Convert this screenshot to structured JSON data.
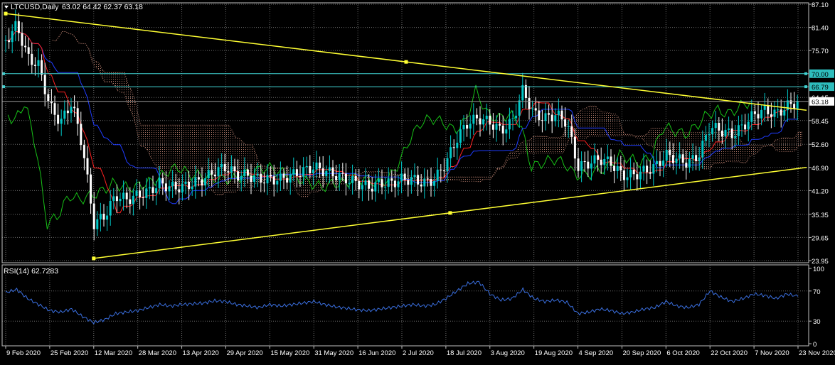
{
  "header": {
    "symbol_label": "LTCUSD,Daily",
    "ohlc_label": "63.02 64.42 62.37 63.18"
  },
  "rsi_header": {
    "label": "RSI(14) 62.7283"
  },
  "colors": {
    "background": "#000000",
    "frame": "#c0c0c0",
    "grid": "#6b6b6b",
    "bull_candle": "#00c8c8",
    "bear_candle": "#ffffff",
    "trendline": "#ffff33",
    "tenkan": "#ff2020",
    "kijun": "#1f3cff",
    "chikou": "#17c017",
    "cloud": "#b07a6a",
    "hline": "#3fcfcf",
    "rsi_line": "#3a6fe0",
    "price_marker_bg": "#ffffff",
    "level_marker_bg": "#2ebdbd"
  },
  "chart_data": [
    {
      "type": "candlestick",
      "title": "LTCUSD,Daily",
      "price_axis_ticks": [
        "87.10",
        "81.40",
        "75.70",
        "64.15",
        "58.45",
        "52.60",
        "46.90",
        "41.20",
        "35.35",
        "29.65",
        "23.95"
      ],
      "x_tick_labels": [
        "9 Feb 2020",
        "25 Feb 2020",
        "12 Mar 2020",
        "28 Mar 2020",
        "13 Apr 2020",
        "29 Apr 2020",
        "15 May 2020",
        "31 May 2020",
        "16 Jun 2020",
        "2 Jul 2020",
        "18 Jul 2020",
        "3 Aug 2020",
        "19 Aug 2020",
        "4 Sep 2020",
        "20 Sep 2020",
        "6 Oct 2020",
        "22 Oct 2020",
        "7 Nov 2020",
        "23 Nov 2020"
      ],
      "ylim": [
        23.95,
        87.1
      ],
      "horizontal_levels": [
        {
          "value": 70.0,
          "label": "70.00"
        },
        {
          "value": 66.79,
          "label": "66.79"
        }
      ],
      "current_price": {
        "value": 63.18,
        "label": "63.18"
      },
      "trendlines": [
        {
          "from": {
            "x": "9 Feb 2020",
            "y": 84.8
          },
          "to": {
            "x": "23 Nov 2020",
            "y": 61.0
          }
        },
        {
          "from": {
            "x": "12 Mar 2020",
            "y": 24.5
          },
          "to": {
            "x": "23 Nov 2020",
            "y": 46.9
          }
        }
      ],
      "indicators": [
        "Ichimoku Kinko Hyo"
      ],
      "closes": [
        {
          "x": "9 Feb 2020",
          "y": 78
        },
        {
          "x": "13 Feb 2020",
          "y": 82
        },
        {
          "x": "17 Feb 2020",
          "y": 74
        },
        {
          "x": "21 Feb 2020",
          "y": 72
        },
        {
          "x": "25 Feb 2020",
          "y": 62
        },
        {
          "x": "29 Feb 2020",
          "y": 58
        },
        {
          "x": "4 Mar 2020",
          "y": 63
        },
        {
          "x": "8 Mar 2020",
          "y": 52
        },
        {
          "x": "12 Mar 2020",
          "y": 33
        },
        {
          "x": "16 Mar 2020",
          "y": 35
        },
        {
          "x": "20 Mar 2020",
          "y": 40
        },
        {
          "x": "24 Mar 2020",
          "y": 39
        },
        {
          "x": "28 Mar 2020",
          "y": 40
        },
        {
          "x": "1 Apr 2020",
          "y": 41
        },
        {
          "x": "5 Apr 2020",
          "y": 43
        },
        {
          "x": "9 Apr 2020",
          "y": 42
        },
        {
          "x": "13 Apr 2020",
          "y": 42
        },
        {
          "x": "17 Apr 2020",
          "y": 43
        },
        {
          "x": "21 Apr 2020",
          "y": 44
        },
        {
          "x": "25 Apr 2020",
          "y": 46
        },
        {
          "x": "29 Apr 2020",
          "y": 47
        },
        {
          "x": "3 May 2020",
          "y": 45
        },
        {
          "x": "7 May 2020",
          "y": 45
        },
        {
          "x": "11 May 2020",
          "y": 44
        },
        {
          "x": "15 May 2020",
          "y": 44
        },
        {
          "x": "19 May 2020",
          "y": 44
        },
        {
          "x": "23 May 2020",
          "y": 45
        },
        {
          "x": "27 May 2020",
          "y": 46
        },
        {
          "x": "31 May 2020",
          "y": 47
        },
        {
          "x": "4 Jun 2020",
          "y": 46
        },
        {
          "x": "8 Jun 2020",
          "y": 45
        },
        {
          "x": "12 Jun 2020",
          "y": 44
        },
        {
          "x": "16 Jun 2020",
          "y": 43
        },
        {
          "x": "20 Jun 2020",
          "y": 42
        },
        {
          "x": "24 Jun 2020",
          "y": 43
        },
        {
          "x": "28 Jun 2020",
          "y": 43
        },
        {
          "x": "2 Jul 2020",
          "y": 44
        },
        {
          "x": "6 Jul 2020",
          "y": 44
        },
        {
          "x": "10 Jul 2020",
          "y": 43
        },
        {
          "x": "14 Jul 2020",
          "y": 44
        },
        {
          "x": "18 Jul 2020",
          "y": 48
        },
        {
          "x": "22 Jul 2020",
          "y": 54
        },
        {
          "x": "26 Jul 2020",
          "y": 58
        },
        {
          "x": "30 Jul 2020",
          "y": 59
        },
        {
          "x": "3 Aug 2020",
          "y": 58
        },
        {
          "x": "7 Aug 2020",
          "y": 56
        },
        {
          "x": "11 Aug 2020",
          "y": 58
        },
        {
          "x": "15 Aug 2020",
          "y": 66
        },
        {
          "x": "19 Aug 2020",
          "y": 60
        },
        {
          "x": "23 Aug 2020",
          "y": 59
        },
        {
          "x": "27 Aug 2020",
          "y": 60
        },
        {
          "x": "31 Aug 2020",
          "y": 58
        },
        {
          "x": "4 Sep 2020",
          "y": 47
        },
        {
          "x": "8 Sep 2020",
          "y": 48
        },
        {
          "x": "12 Sep 2020",
          "y": 49
        },
        {
          "x": "16 Sep 2020",
          "y": 48
        },
        {
          "x": "20 Sep 2020",
          "y": 45
        },
        {
          "x": "24 Sep 2020",
          "y": 45
        },
        {
          "x": "28 Sep 2020",
          "y": 46
        },
        {
          "x": "2 Oct 2020",
          "y": 47
        },
        {
          "x": "6 Oct 2020",
          "y": 50
        },
        {
          "x": "10 Oct 2020",
          "y": 49
        },
        {
          "x": "14 Oct 2020",
          "y": 48
        },
        {
          "x": "18 Oct 2020",
          "y": 50
        },
        {
          "x": "22 Oct 2020",
          "y": 57
        },
        {
          "x": "26 Oct 2020",
          "y": 56
        },
        {
          "x": "30 Oct 2020",
          "y": 55
        },
        {
          "x": "3 Nov 2020",
          "y": 57
        },
        {
          "x": "7 Nov 2020",
          "y": 60
        },
        {
          "x": "11 Nov 2020",
          "y": 61
        },
        {
          "x": "15 Nov 2020",
          "y": 60
        },
        {
          "x": "19 Nov 2020",
          "y": 62
        },
        {
          "x": "23 Nov 2020",
          "y": 63.18
        }
      ]
    },
    {
      "type": "line",
      "title": "RSI(14) 62.7283",
      "ylim": [
        0,
        100
      ],
      "y_tick_labels": [
        "100",
        "70",
        "30",
        "0"
      ],
      "guide_levels": [
        70,
        30
      ],
      "series": [
        {
          "name": "RSI(14)",
          "values": [
            {
              "x": "9 Feb 2020",
              "y": 68
            },
            {
              "x": "13 Feb 2020",
              "y": 72
            },
            {
              "x": "17 Feb 2020",
              "y": 60
            },
            {
              "x": "21 Feb 2020",
              "y": 52
            },
            {
              "x": "25 Feb 2020",
              "y": 44
            },
            {
              "x": "29 Feb 2020",
              "y": 42
            },
            {
              "x": "4 Mar 2020",
              "y": 46
            },
            {
              "x": "8 Mar 2020",
              "y": 36
            },
            {
              "x": "12 Mar 2020",
              "y": 28
            },
            {
              "x": "16 Mar 2020",
              "y": 32
            },
            {
              "x": "20 Mar 2020",
              "y": 40
            },
            {
              "x": "24 Mar 2020",
              "y": 42
            },
            {
              "x": "28 Mar 2020",
              "y": 44
            },
            {
              "x": "1 Apr 2020",
              "y": 48
            },
            {
              "x": "5 Apr 2020",
              "y": 52
            },
            {
              "x": "9 Apr 2020",
              "y": 50
            },
            {
              "x": "13 Apr 2020",
              "y": 52
            },
            {
              "x": "17 Apr 2020",
              "y": 53
            },
            {
              "x": "21 Apr 2020",
              "y": 54
            },
            {
              "x": "25 Apr 2020",
              "y": 57
            },
            {
              "x": "29 Apr 2020",
              "y": 56
            },
            {
              "x": "3 May 2020",
              "y": 52
            },
            {
              "x": "7 May 2020",
              "y": 50
            },
            {
              "x": "11 May 2020",
              "y": 48
            },
            {
              "x": "15 May 2020",
              "y": 52
            },
            {
              "x": "19 May 2020",
              "y": 50
            },
            {
              "x": "23 May 2020",
              "y": 52
            },
            {
              "x": "27 May 2020",
              "y": 54
            },
            {
              "x": "31 May 2020",
              "y": 56
            },
            {
              "x": "4 Jun 2020",
              "y": 52
            },
            {
              "x": "8 Jun 2020",
              "y": 49
            },
            {
              "x": "12 Jun 2020",
              "y": 47
            },
            {
              "x": "16 Jun 2020",
              "y": 45
            },
            {
              "x": "20 Jun 2020",
              "y": 44
            },
            {
              "x": "24 Jun 2020",
              "y": 46
            },
            {
              "x": "28 Jun 2020",
              "y": 48
            },
            {
              "x": "2 Jul 2020",
              "y": 50
            },
            {
              "x": "6 Jul 2020",
              "y": 52
            },
            {
              "x": "10 Jul 2020",
              "y": 50
            },
            {
              "x": "14 Jul 2020",
              "y": 52
            },
            {
              "x": "18 Jul 2020",
              "y": 60
            },
            {
              "x": "22 Jul 2020",
              "y": 70
            },
            {
              "x": "26 Jul 2020",
              "y": 80
            },
            {
              "x": "30 Jul 2020",
              "y": 82
            },
            {
              "x": "3 Aug 2020",
              "y": 66
            },
            {
              "x": "7 Aug 2020",
              "y": 58
            },
            {
              "x": "11 Aug 2020",
              "y": 60
            },
            {
              "x": "15 Aug 2020",
              "y": 72
            },
            {
              "x": "19 Aug 2020",
              "y": 60
            },
            {
              "x": "23 Aug 2020",
              "y": 56
            },
            {
              "x": "27 Aug 2020",
              "y": 58
            },
            {
              "x": "31 Aug 2020",
              "y": 55
            },
            {
              "x": "4 Sep 2020",
              "y": 40
            },
            {
              "x": "8 Sep 2020",
              "y": 42
            },
            {
              "x": "12 Sep 2020",
              "y": 46
            },
            {
              "x": "16 Sep 2020",
              "y": 44
            },
            {
              "x": "20 Sep 2020",
              "y": 40
            },
            {
              "x": "24 Sep 2020",
              "y": 42
            },
            {
              "x": "28 Sep 2020",
              "y": 46
            },
            {
              "x": "2 Oct 2020",
              "y": 48
            },
            {
              "x": "6 Oct 2020",
              "y": 56
            },
            {
              "x": "10 Oct 2020",
              "y": 50
            },
            {
              "x": "14 Oct 2020",
              "y": 48
            },
            {
              "x": "18 Oct 2020",
              "y": 52
            },
            {
              "x": "22 Oct 2020",
              "y": 70
            },
            {
              "x": "26 Oct 2020",
              "y": 62
            },
            {
              "x": "30 Oct 2020",
              "y": 56
            },
            {
              "x": "3 Nov 2020",
              "y": 60
            },
            {
              "x": "7 Nov 2020",
              "y": 66
            },
            {
              "x": "11 Nov 2020",
              "y": 64
            },
            {
              "x": "15 Nov 2020",
              "y": 60
            },
            {
              "x": "19 Nov 2020",
              "y": 66
            },
            {
              "x": "23 Nov 2020",
              "y": 62.7
            }
          ]
        }
      ]
    }
  ]
}
